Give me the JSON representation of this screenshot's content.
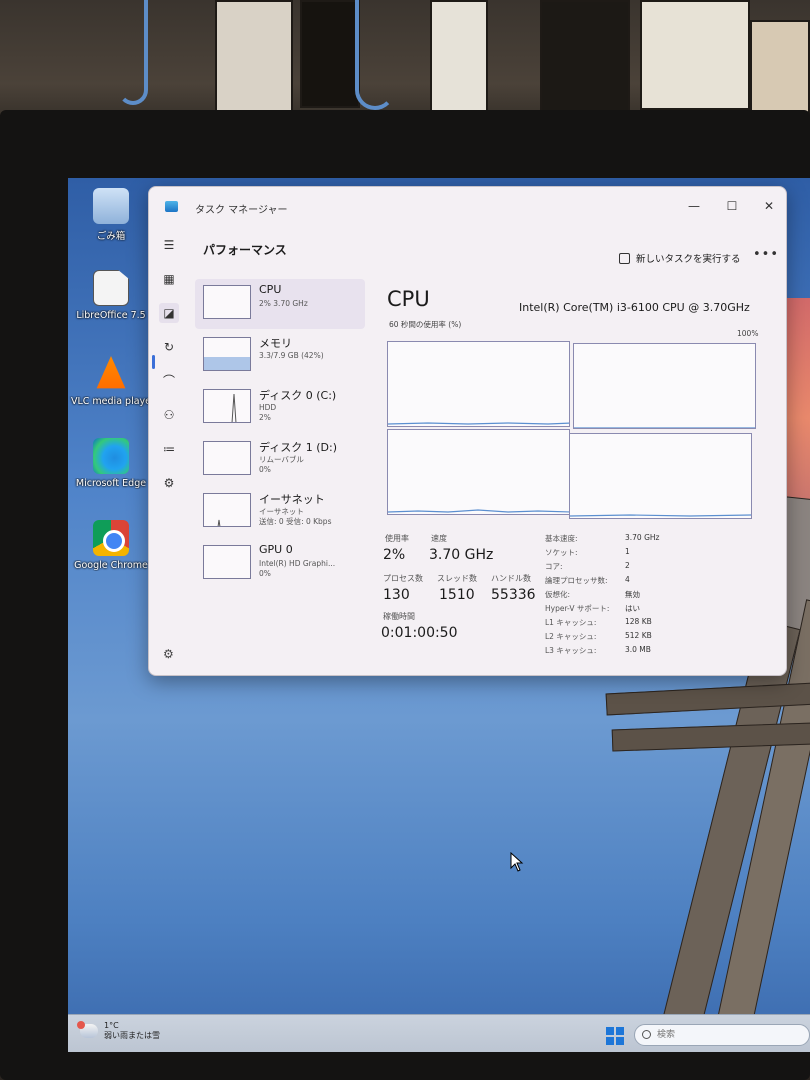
{
  "desktop": {
    "icons": [
      {
        "label": "ごみ箱",
        "icon": "recycle-bin-icon"
      },
      {
        "label": "LibreOffice 7.5",
        "icon": "libreoffice-icon"
      },
      {
        "label": "VLC media playe",
        "icon": "vlc-icon"
      },
      {
        "label": "Microsoft Edge",
        "icon": "edge-icon"
      },
      {
        "label": "Google Chrome",
        "icon": "chrome-icon"
      }
    ]
  },
  "window": {
    "title": "タスク マネージャー",
    "controls": {
      "min": "—",
      "max": "☐",
      "close": "✕"
    }
  },
  "header": {
    "title": "パフォーマンス",
    "run_task": "新しいタスクを実行する",
    "more": "•••"
  },
  "perf_items": [
    {
      "name": "CPU",
      "sub": "2% 3.70 GHz"
    },
    {
      "name": "メモリ",
      "sub": "3.3/7.9 GB (42%)"
    },
    {
      "name": "ディスク 0 (C:)",
      "sub": "HDD",
      "sub2": "2%"
    },
    {
      "name": "ディスク 1 (D:)",
      "sub": "リムーバブル",
      "sub2": "0%"
    },
    {
      "name": "イーサネット",
      "sub": "イーサネット",
      "sub2": "送信: 0 受信: 0 Kbps"
    },
    {
      "name": "GPU 0",
      "sub": "Intel(R) HD Graphi...",
      "sub2": "0%"
    }
  ],
  "memory_usage_fraction": 0.42,
  "detail": {
    "title": "CPU",
    "model": "Intel(R) Core(TM) i3-6100 CPU @ 3.70GHz",
    "graph_caption": "60 秒間の使用率 (%)",
    "graph_max": "100%",
    "stats": {
      "usage_label": "使用率",
      "usage": "2%",
      "speed_label": "速度",
      "speed": "3.70 GHz",
      "processes_label": "プロセス数",
      "processes": "130",
      "threads_label": "スレッド数",
      "threads": "1510",
      "handles_label": "ハンドル数",
      "handles": "55336",
      "uptime_label": "稼働時間",
      "uptime": "0:01:00:50"
    },
    "specs": [
      {
        "key": "基本速度:",
        "value": "3.70 GHz"
      },
      {
        "key": "ソケット:",
        "value": "1"
      },
      {
        "key": "コア:",
        "value": "2"
      },
      {
        "key": "論理プロセッサ数:",
        "value": "4"
      },
      {
        "key": "仮想化:",
        "value": "無効"
      },
      {
        "key": "Hyper-V サポート:",
        "value": "はい"
      },
      {
        "key": "L1 キャッシュ:",
        "value": "128 KB"
      },
      {
        "key": "L2 キャッシュ:",
        "value": "512 KB"
      },
      {
        "key": "L3 キャッシュ:",
        "value": "3.0 MB"
      }
    ]
  },
  "taskbar": {
    "weather_temp": "1°C",
    "weather_text": "弱い雨または雪",
    "search_placeholder": "検索"
  },
  "colors": {
    "graph_line": "#5b8fd0",
    "graph_border": "#8a8ab0",
    "start_blue": "#1d76d8"
  }
}
